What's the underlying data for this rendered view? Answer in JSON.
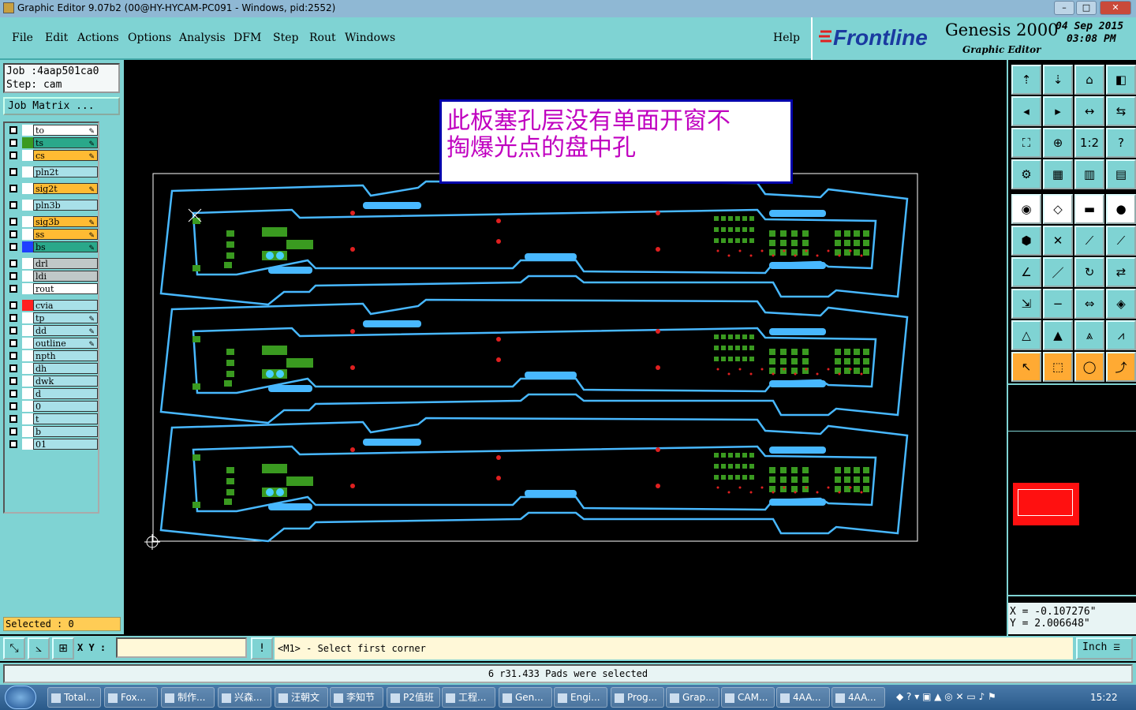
{
  "window": {
    "title": "Graphic Editor 9.07b2 (00@HY-HYCAM-PC091 - Windows, pid:2552)"
  },
  "menu": {
    "items": [
      "File",
      "Edit",
      "Actions",
      "Options",
      "Analysis",
      "DFM",
      "Step",
      "Rout",
      "Windows"
    ],
    "help": "Help"
  },
  "brand": {
    "logo": "Frontline",
    "product": "Genesis 2000",
    "subtitle": "Graphic Editor",
    "date": "04 Sep 2015",
    "time": "03:08 PM"
  },
  "job": {
    "job_line": "Job  :4aap501ca0",
    "step_line": "Step: cam",
    "matrix_button": "Job Matrix ..."
  },
  "layers": [
    {
      "name": "to",
      "color": "#ffffff",
      "swatch": "#ffffff",
      "pen": true
    },
    {
      "name": "ts",
      "color": "#2aa88a",
      "swatch": "#3a9a20",
      "pen": true
    },
    {
      "name": "cs",
      "color": "#ffbb33",
      "swatch": "#ffffff",
      "pen": true
    },
    {
      "name": "pln2t",
      "color": "#a8e0e8",
      "swatch": "#ffffff",
      "pen": false
    },
    {
      "name": "sig2t",
      "color": "#ffbb33",
      "swatch": "#ffffff",
      "pen": true
    },
    {
      "name": "pln3b",
      "color": "#a8e0e8",
      "swatch": "#ffffff",
      "pen": false
    },
    {
      "name": "sig3b",
      "color": "#ffbb33",
      "swatch": "#ffffff",
      "pen": true
    },
    {
      "name": "ss",
      "color": "#ffbb33",
      "swatch": "#ffffff",
      "pen": true
    },
    {
      "name": "bs",
      "color": "#2aa88a",
      "swatch": "#2040ff",
      "pen": true
    },
    {
      "name": "drl",
      "color": "#c0c8c8",
      "swatch": "#ffffff",
      "pen": false
    },
    {
      "name": "ldi",
      "color": "#c0c8c8",
      "swatch": "#ffffff",
      "pen": false
    },
    {
      "name": "rout",
      "color": "#ffffff",
      "swatch": "#ffffff",
      "pen": false
    },
    {
      "name": "cvia",
      "color": "#a8e0e8",
      "swatch": "#ff2020",
      "pen": false
    },
    {
      "name": "tp",
      "color": "#a8e0e8",
      "swatch": "#ffffff",
      "pen": true
    },
    {
      "name": "dd",
      "color": "#a8e0e8",
      "swatch": "#ffffff",
      "pen": true
    },
    {
      "name": "outline",
      "color": "#a8e0e8",
      "swatch": "#ffffff",
      "pen": true
    },
    {
      "name": "npth",
      "color": "#a8e0e8",
      "swatch": "#ffffff",
      "pen": false
    },
    {
      "name": "dh",
      "color": "#a8e0e8",
      "swatch": "#ffffff",
      "pen": false
    },
    {
      "name": "dwk",
      "color": "#a8e0e8",
      "swatch": "#ffffff",
      "pen": false
    },
    {
      "name": "d",
      "color": "#a8e0e8",
      "swatch": "#ffffff",
      "pen": false
    },
    {
      "name": "0",
      "color": "#a8e0e8",
      "swatch": "#ffffff",
      "pen": false
    },
    {
      "name": "t",
      "color": "#a8e0e8",
      "swatch": "#ffffff",
      "pen": false
    },
    {
      "name": "b",
      "color": "#a8e0e8",
      "swatch": "#ffffff",
      "pen": false
    },
    {
      "name": "01",
      "color": "#a8e0e8",
      "swatch": "#ffffff",
      "pen": false
    }
  ],
  "selected": "Selected : 0",
  "annotation": {
    "line1": "此板塞孔层没有单面开窗不",
    "line2": "掏爆光点的盘中孔"
  },
  "coords": {
    "x": "X  = -0.107276\"",
    "y": "Y  = 2.006648\""
  },
  "bottom": {
    "xy_label": "X Y :",
    "xy_value": "",
    "prompt": "<M1> - Select first corner",
    "unit": "Inch"
  },
  "status": "6 r31.433 Pads were selected",
  "taskbar": {
    "tasks": [
      "Total...",
      "Fox...",
      "制作...",
      "兴森...",
      "汪朝文",
      "李知节",
      "P2值班",
      "工程...",
      "Gen...",
      "Engi...",
      "Prog...",
      "Grap...",
      "CAM...",
      "4AA...",
      "4AA..."
    ],
    "clock": "15:22"
  },
  "colors": {
    "board_outline": "#48b8ff",
    "pad_green": "#3a9a20",
    "pad_red": "#e02020",
    "panel_bg": "#7fd3d3"
  }
}
